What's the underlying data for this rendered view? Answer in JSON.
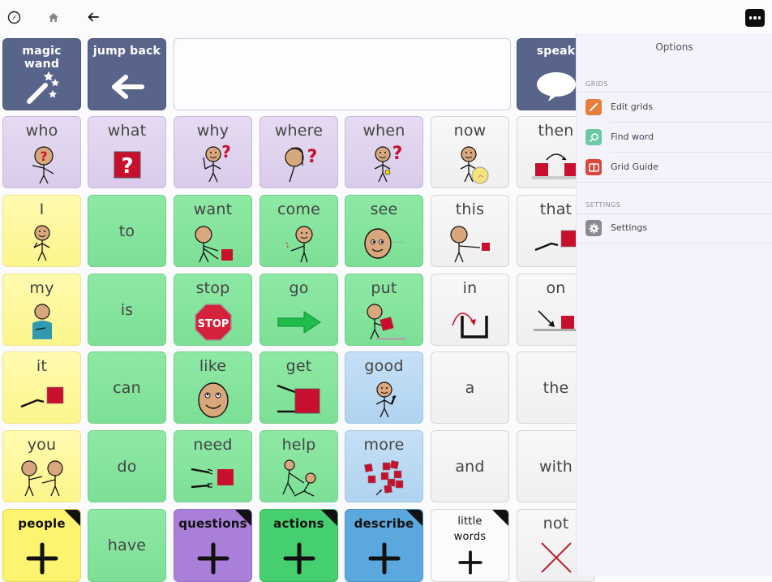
{
  "topbar": {
    "icons": [
      "compass-icon",
      "home-icon",
      "back-arrow-icon"
    ],
    "more_button": "more-options-icon"
  },
  "nav_row": [
    {
      "label": "magic wand",
      "icon": "magic-wand-icon"
    },
    {
      "label": "jump back",
      "icon": "arrow-left-icon"
    },
    {
      "label": "speak",
      "icon": "speech-bubble-icon"
    }
  ],
  "message_bar": {
    "value": ""
  },
  "grid": {
    "rows": [
      [
        {
          "label": "who",
          "color": "purple",
          "symbol": "person-question"
        },
        {
          "label": "what",
          "color": "purple",
          "symbol": "question-box"
        },
        {
          "label": "why",
          "color": "purple",
          "symbol": "person-thinking"
        },
        {
          "label": "where",
          "color": "purple",
          "symbol": "person-looking"
        },
        {
          "label": "when",
          "color": "purple",
          "symbol": "person-watch"
        },
        {
          "label": "now",
          "color": "white",
          "symbol": "person-clock"
        },
        {
          "label": "then",
          "color": "white",
          "symbol": "two-boxes-arrow"
        }
      ],
      [
        {
          "label": "I",
          "color": "yellow",
          "symbol": "person-self"
        },
        {
          "label": "to",
          "color": "green",
          "symbol": ""
        },
        {
          "label": "want",
          "color": "green",
          "symbol": "person-reach-box"
        },
        {
          "label": "come",
          "color": "green",
          "symbol": "person-beckon"
        },
        {
          "label": "see",
          "color": "green",
          "symbol": "face-look"
        },
        {
          "label": "this",
          "color": "white",
          "symbol": "person-point-box"
        },
        {
          "label": "that",
          "color": "white",
          "symbol": "hand-point-box"
        }
      ],
      [
        {
          "label": "my",
          "color": "yellow",
          "symbol": "person-chest"
        },
        {
          "label": "is",
          "color": "green",
          "symbol": ""
        },
        {
          "label": "stop",
          "color": "green",
          "symbol": "stop-sign"
        },
        {
          "label": "go",
          "color": "green",
          "symbol": "green-arrow"
        },
        {
          "label": "put",
          "color": "green",
          "symbol": "person-put-box"
        },
        {
          "label": "in",
          "color": "white",
          "symbol": "arrow-into-container"
        },
        {
          "label": "on",
          "color": "white",
          "symbol": "arrow-onto-box"
        }
      ],
      [
        {
          "label": "it",
          "color": "yellow",
          "symbol": "hand-point-box"
        },
        {
          "label": "can",
          "color": "green",
          "symbol": ""
        },
        {
          "label": "like",
          "color": "green",
          "symbol": "smiley-face"
        },
        {
          "label": "get",
          "color": "green",
          "symbol": "hands-grab-box"
        },
        {
          "label": "good",
          "color": "blue",
          "symbol": "person-thumbs-up"
        },
        {
          "label": "a",
          "color": "white",
          "symbol": ""
        },
        {
          "label": "the",
          "color": "white",
          "symbol": ""
        }
      ],
      [
        {
          "label": "you",
          "color": "yellow",
          "symbol": "two-people-pointing"
        },
        {
          "label": "do",
          "color": "green",
          "symbol": ""
        },
        {
          "label": "need",
          "color": "green",
          "symbol": "hands-reach-box"
        },
        {
          "label": "help",
          "color": "green",
          "symbol": "person-helping"
        },
        {
          "label": "more",
          "color": "blue",
          "symbol": "many-boxes"
        },
        {
          "label": "and",
          "color": "white",
          "symbol": ""
        },
        {
          "label": "with",
          "color": "white",
          "symbol": ""
        }
      ],
      [
        {
          "label": "people",
          "color": "cat-yellow",
          "symbol": "plus",
          "folder": true
        },
        {
          "label": "have",
          "color": "green",
          "symbol": ""
        },
        {
          "label": "questions",
          "color": "cat-purple",
          "symbol": "plus",
          "folder": true
        },
        {
          "label": "actions",
          "color": "cat-green",
          "symbol": "plus",
          "folder": true
        },
        {
          "label": "describe",
          "color": "cat-blue",
          "symbol": "plus",
          "folder": true
        },
        {
          "label": "little words",
          "color": "cat-white",
          "symbol": "plus",
          "folder": true
        },
        {
          "label": "not",
          "color": "white",
          "symbol": "red-x"
        }
      ]
    ]
  },
  "options_panel": {
    "title": "Options",
    "sections": [
      {
        "heading": "GRIDS",
        "items": [
          {
            "label": "Edit grids",
            "icon": "pencil-icon",
            "color": "#e57d3d"
          },
          {
            "label": "Find word",
            "icon": "magnifier-icon",
            "color": "#6cc9a5"
          },
          {
            "label": "Grid Guide",
            "icon": "book-icon",
            "color": "#d9473f"
          }
        ]
      },
      {
        "heading": "SETTINGS",
        "items": [
          {
            "label": "Settings",
            "icon": "gear-icon",
            "color": "#8a8a8f"
          }
        ]
      }
    ]
  }
}
